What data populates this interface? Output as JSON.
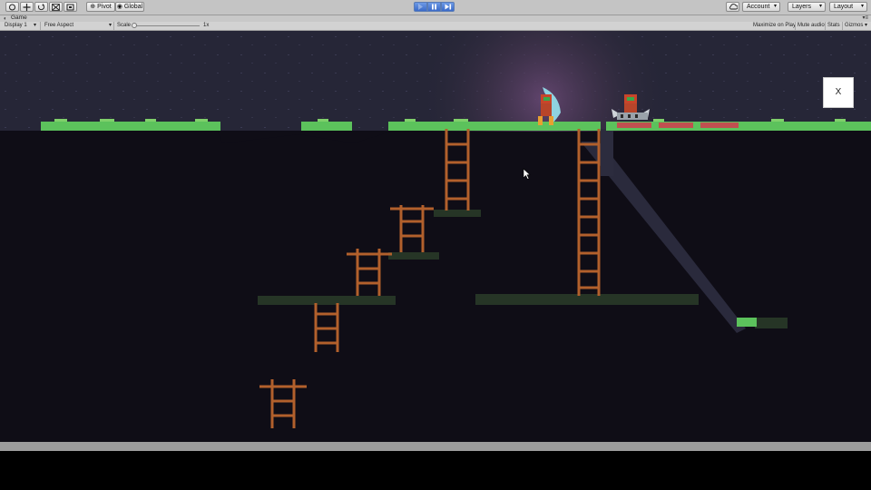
{
  "toolbar": {
    "tools": [
      {
        "name": "hand-tool-button",
        "icon": "hand-icon"
      },
      {
        "name": "move-tool-button",
        "icon": "move-icon"
      },
      {
        "name": "rotate-tool-button",
        "icon": "rotate-icon"
      },
      {
        "name": "scale-tool-button",
        "icon": "scale-icon"
      },
      {
        "name": "rect-tool-button",
        "icon": "rect-icon"
      }
    ],
    "pivot_label": "Pivot",
    "global_label": "Global",
    "playback": {
      "play_icon": "play-icon",
      "pause_icon": "pause-icon",
      "step_icon": "step-icon"
    },
    "cloud_icon": "cloud-icon",
    "account_label": "Account",
    "layers_label": "Layers",
    "layout_label": "Layout"
  },
  "game_tab": {
    "label": "Game"
  },
  "game_bar": {
    "display": "Display 1",
    "aspect": "Free Aspect",
    "scale_label": "Scale",
    "scale_value": "1x",
    "maximize": "Maximize on Play",
    "mute": "Mute audio",
    "stats": "Stats",
    "gizmos": "Gizmos"
  },
  "game": {
    "close_label": "X"
  },
  "colors": {
    "sky": "#262637",
    "ground": "#0f0d16",
    "grass": "#5cc25c",
    "ladder": "#b2602c",
    "play_accent": "#4a7bd4",
    "hazard": "#c05050"
  }
}
